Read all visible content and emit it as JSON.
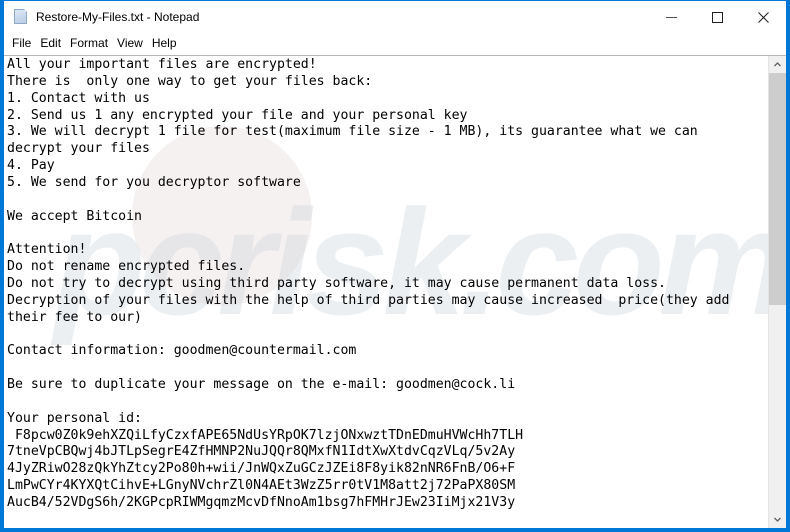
{
  "window": {
    "title": "Restore-My-Files.txt - Notepad",
    "icon": "notepad-document-icon",
    "accent_color": "#0078d7",
    "background_color": "#ffffff",
    "text_color": "#000000"
  },
  "window_controls": {
    "minimize_label": "Minimize",
    "maximize_label": "Maximize",
    "close_label": "Close"
  },
  "menubar": {
    "items": [
      {
        "label": "File"
      },
      {
        "label": "Edit"
      },
      {
        "label": "Format"
      },
      {
        "label": "View"
      },
      {
        "label": "Help"
      }
    ]
  },
  "document": {
    "filename": "Restore-My-Files.txt",
    "content": "All your important files are encrypted!\nThere is  only one way to get your files back:\n1. Contact with us\n2. Send us 1 any encrypted your file and your personal key\n3. We will decrypt 1 file for test(maximum file size - 1 MB), its guarantee what we can\ndecrypt your files\n4. Pay\n5. We send for you decryptor software\n\nWe accept Bitcoin\n\nAttention!\nDo not rename encrypted files.\nDo not try to decrypt using third party software, it may cause permanent data loss.\nDecryption of your files with the help of third parties may cause increased  price(they add\ntheir fee to our)\n\nContact information: goodmen@countermail.com\n\nBe sure to duplicate your message on the e-mail: goodmen@cock.li\n\nYour personal id:\n F8pcw0Z0k9ehXZQiLfyCzxfAPE65NdUsYRpOK7lzjONxwztTDnEDmuHVWcHh7TLH\n7tneVpCBQwj4bJTLpSegrE4ZfHMNP2NuJQQr8QMxfN1IdtXwXtdvCqzVLq/5v2Ay\n4JyZRiwO28zQkYhZtcy2Po80h+wii/JnWQxZuGCzJZEi8F8yik82nNR6FnB/O6+F\nLmPwCYr4KYXQtCihvE+LGnyNVchrZl0N4AEt3WzZ5rr0tV1M8att2j72PaPX80SM\nAucB4/52VDgS6h/2KGPcpRIWMgqmzMcvDfNnoAm1bsg7hFMHrJEw23IiMjx21V3y",
    "emails": [
      "goodmen@countermail.com",
      "goodmen@cock.li"
    ],
    "payment_method": "Bitcoin",
    "personal_id_lines": [
      " F8pcw0Z0k9ehXZQiLfyCzxfAPE65NdUsYRpOK7lzjONxwztTDnEDmuHVWcHh7TLH",
      "7tneVpCBQwj4bJTLpSegrE4ZfHMNP2NuJQQr8QMxfN1IdtXwXtdvCqzVLq/5v2Ay",
      "4JyZRiwO28zQkYhZtcy2Po80h+wii/JnWQxZuGCzJZEi8F8yik82nNR6FnB/O6+F",
      "LmPwCYr4KYXQtCihvE+LGnyNVchrZl0N4AEt3WzZ5rr0tV1M8att2j72PaPX80SM",
      "AucB4/52VDgS6h/2KGPcpRIWMgqmzMcvDfNnoAm1bsg7hFMHrJEw23IiMjx21V3y"
    ]
  },
  "watermark": {
    "text": "pcrisk.com"
  },
  "scrollbar": {
    "up_arrow": "▲",
    "down_arrow": "▼"
  }
}
